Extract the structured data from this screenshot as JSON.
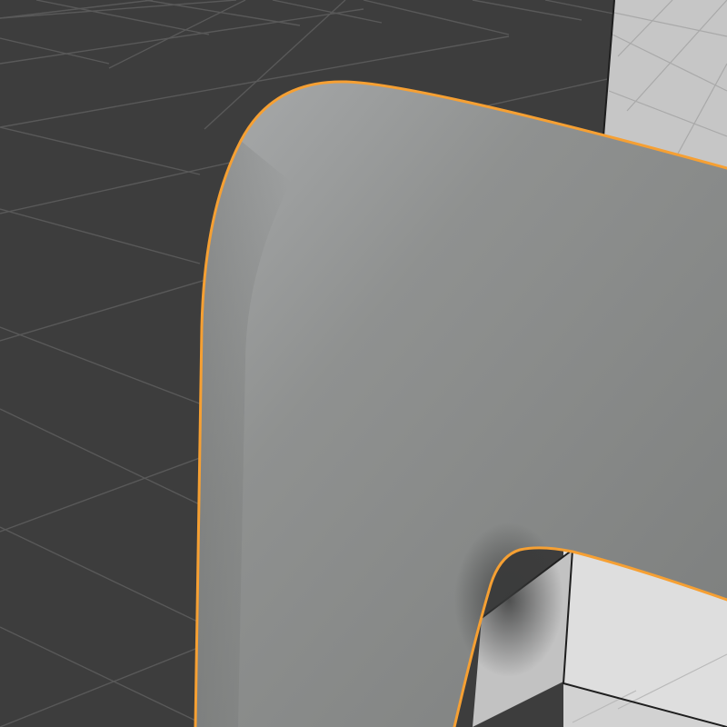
{
  "viewport": {
    "background_color": "#3d3d3d",
    "grid_color": "#5a5a5a",
    "selection_outline_color": "#f5a030",
    "selected_object": {
      "shape": "rounded-frame",
      "base_color": "#8c8e8d",
      "highlight_color": "#a9abac",
      "shadow_color": "#6c6e6d"
    },
    "background_cube": {
      "light_face_color": "#c5c5c5",
      "front_face_color": "#dcdcdc",
      "side_face_color": "#b9b9b9",
      "edge_color": "#1e1e1e"
    }
  }
}
